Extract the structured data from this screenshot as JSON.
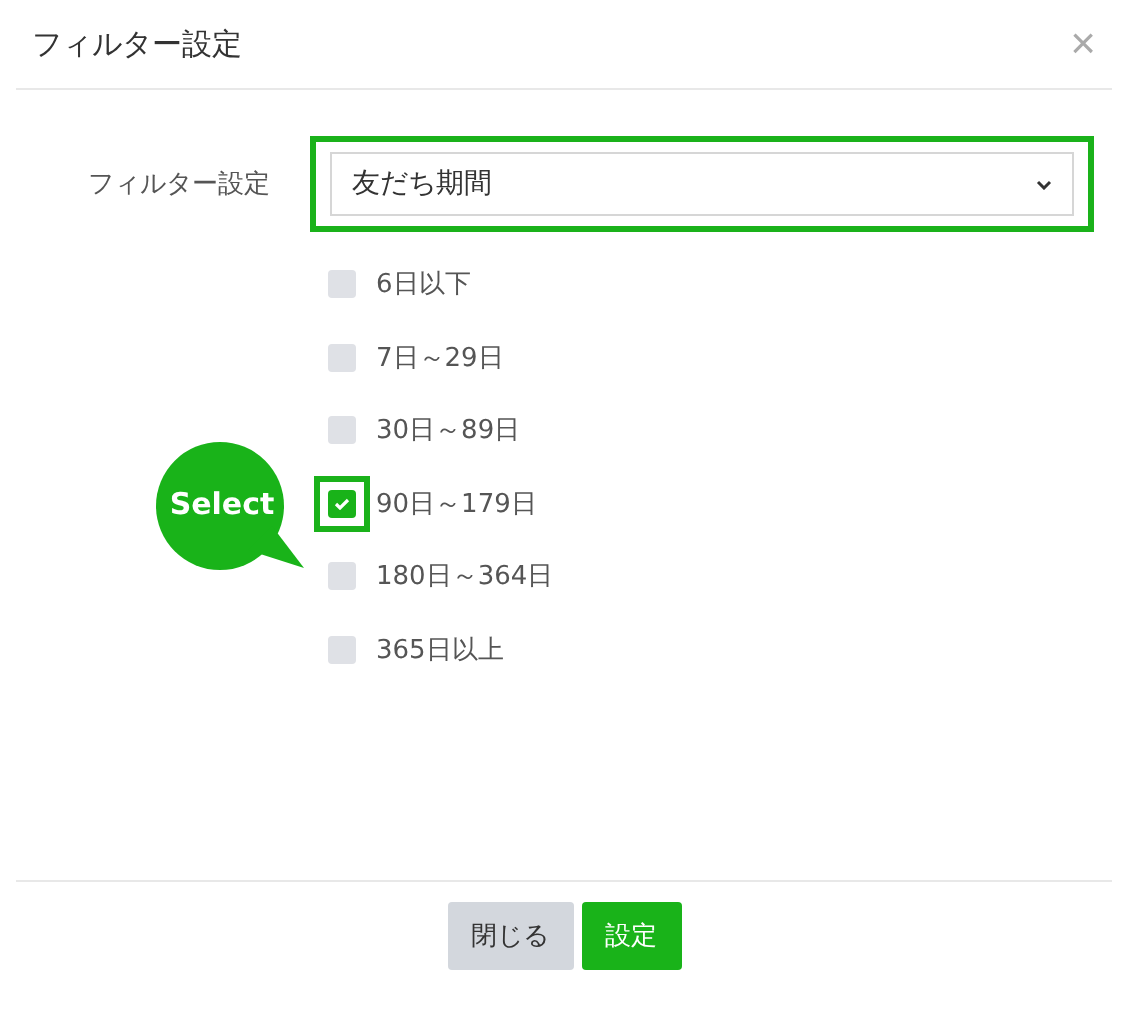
{
  "dialog": {
    "title": "フィルター設定",
    "close_icon": "×"
  },
  "filter": {
    "label": "フィルター設定",
    "value": "友だち期間",
    "highlighted": true
  },
  "options": [
    {
      "label": "6日以下",
      "checked": false,
      "highlighted": false
    },
    {
      "label": "7日～29日",
      "checked": false,
      "highlighted": false
    },
    {
      "label": "30日～89日",
      "checked": false,
      "highlighted": false
    },
    {
      "label": "90日～179日",
      "checked": true,
      "highlighted": true
    },
    {
      "label": "180日～364日",
      "checked": false,
      "highlighted": false
    },
    {
      "label": "365日以上",
      "checked": false,
      "highlighted": false
    }
  ],
  "callout": {
    "text": "Select"
  },
  "buttons": [
    {
      "label": "閉じる",
      "kind": "secondary"
    },
    {
      "label": "設定",
      "kind": "primary"
    }
  ]
}
